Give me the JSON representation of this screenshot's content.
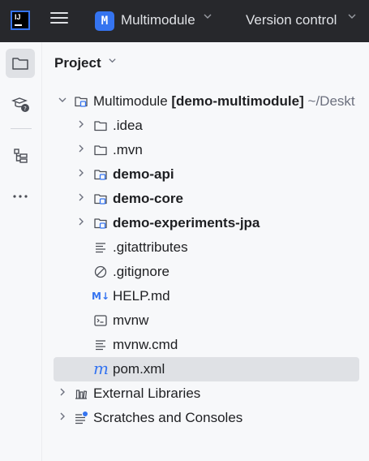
{
  "titlebar": {
    "logo_text": "IJ",
    "project_badge": "M",
    "project_name": "Multimodule",
    "vcs_label": "Version control"
  },
  "panel": {
    "title": "Project"
  },
  "tree": {
    "root_label": "Multimodule",
    "root_module": "[demo-multimodule]",
    "root_path": "~/Deskt",
    "items": [
      {
        "label": ".idea",
        "icon": "folder-icon"
      },
      {
        "label": ".mvn",
        "icon": "folder-icon"
      },
      {
        "label": "demo-api",
        "icon": "module-folder-icon"
      },
      {
        "label": "demo-core",
        "icon": "module-folder-icon"
      },
      {
        "label": "demo-experiments-jpa",
        "icon": "module-folder-icon"
      },
      {
        "label": ".gitattributes",
        "icon": "text-file-icon"
      },
      {
        "label": ".gitignore",
        "icon": "ignore-file-icon"
      },
      {
        "label": "HELP.md",
        "icon": "markdown-icon",
        "icon_text": "M↓"
      },
      {
        "label": "mvnw",
        "icon": "shell-script-icon"
      },
      {
        "label": "mvnw.cmd",
        "icon": "text-file-icon"
      },
      {
        "label": "pom.xml",
        "icon": "maven-icon",
        "icon_text": "m"
      },
      {
        "label": "External Libraries",
        "icon": "libraries-icon"
      },
      {
        "label": "Scratches and Consoles",
        "icon": "scratches-icon"
      }
    ]
  },
  "colors": {
    "titlebar_bg": "#27282c",
    "accent": "#3574f0",
    "selection": "#dfe1e5",
    "panel_bg": "#f7f8fa"
  }
}
